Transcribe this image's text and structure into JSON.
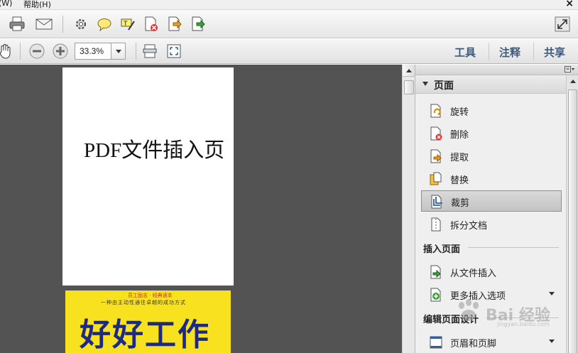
{
  "menubar": {
    "items": [
      {
        "label": "(W)"
      },
      {
        "label": "帮助(H)"
      }
    ],
    "close_label": "×"
  },
  "toolbar1": {
    "icons": [
      "print-icon",
      "email-icon",
      "gear-icon",
      "comment-icon",
      "highlight-icon",
      "delete-page-icon",
      "extract-page-icon",
      "insert-page-icon",
      "fullscreen-icon"
    ]
  },
  "toolbar2": {
    "zoom_value": "33.3%",
    "links": [
      {
        "label": "工具"
      },
      {
        "label": "注释"
      },
      {
        "label": "共享"
      }
    ]
  },
  "document": {
    "page1_text": "PDF文件插入页",
    "page2": {
      "sub1": "员工励志 · 经典读本",
      "sub2": "一种由主动性通往卓越的成功方式",
      "title": "好好工作"
    }
  },
  "panel": {
    "section_title": "页面",
    "items": [
      {
        "label": "旋转",
        "icon": "rotate-icon"
      },
      {
        "label": "删除",
        "icon": "delete-icon"
      },
      {
        "label": "提取",
        "icon": "extract-icon"
      },
      {
        "label": "替换",
        "icon": "replace-icon"
      },
      {
        "label": "裁剪",
        "icon": "crop-icon",
        "selected": true
      },
      {
        "label": "拆分文档",
        "icon": "split-document-icon"
      }
    ],
    "insert_group": {
      "label": "插入页面",
      "items": [
        {
          "label": "从文件插入",
          "icon": "insert-from-file-icon"
        },
        {
          "label": "更多插入选项",
          "icon": "more-insert-icon"
        }
      ]
    },
    "design_group": {
      "label": "编辑页面设计",
      "items": [
        {
          "label": "页眉和页脚",
          "icon": "header-footer-icon"
        }
      ]
    }
  },
  "watermark": {
    "text": "Bai 经验",
    "url": "jingyan.baidu.com"
  },
  "colors": {
    "doc_background": "#535353",
    "cover_yellow": "#f8e11f",
    "cover_title_blue": "#1c2a86",
    "link_blue": "#3d5a7a"
  }
}
